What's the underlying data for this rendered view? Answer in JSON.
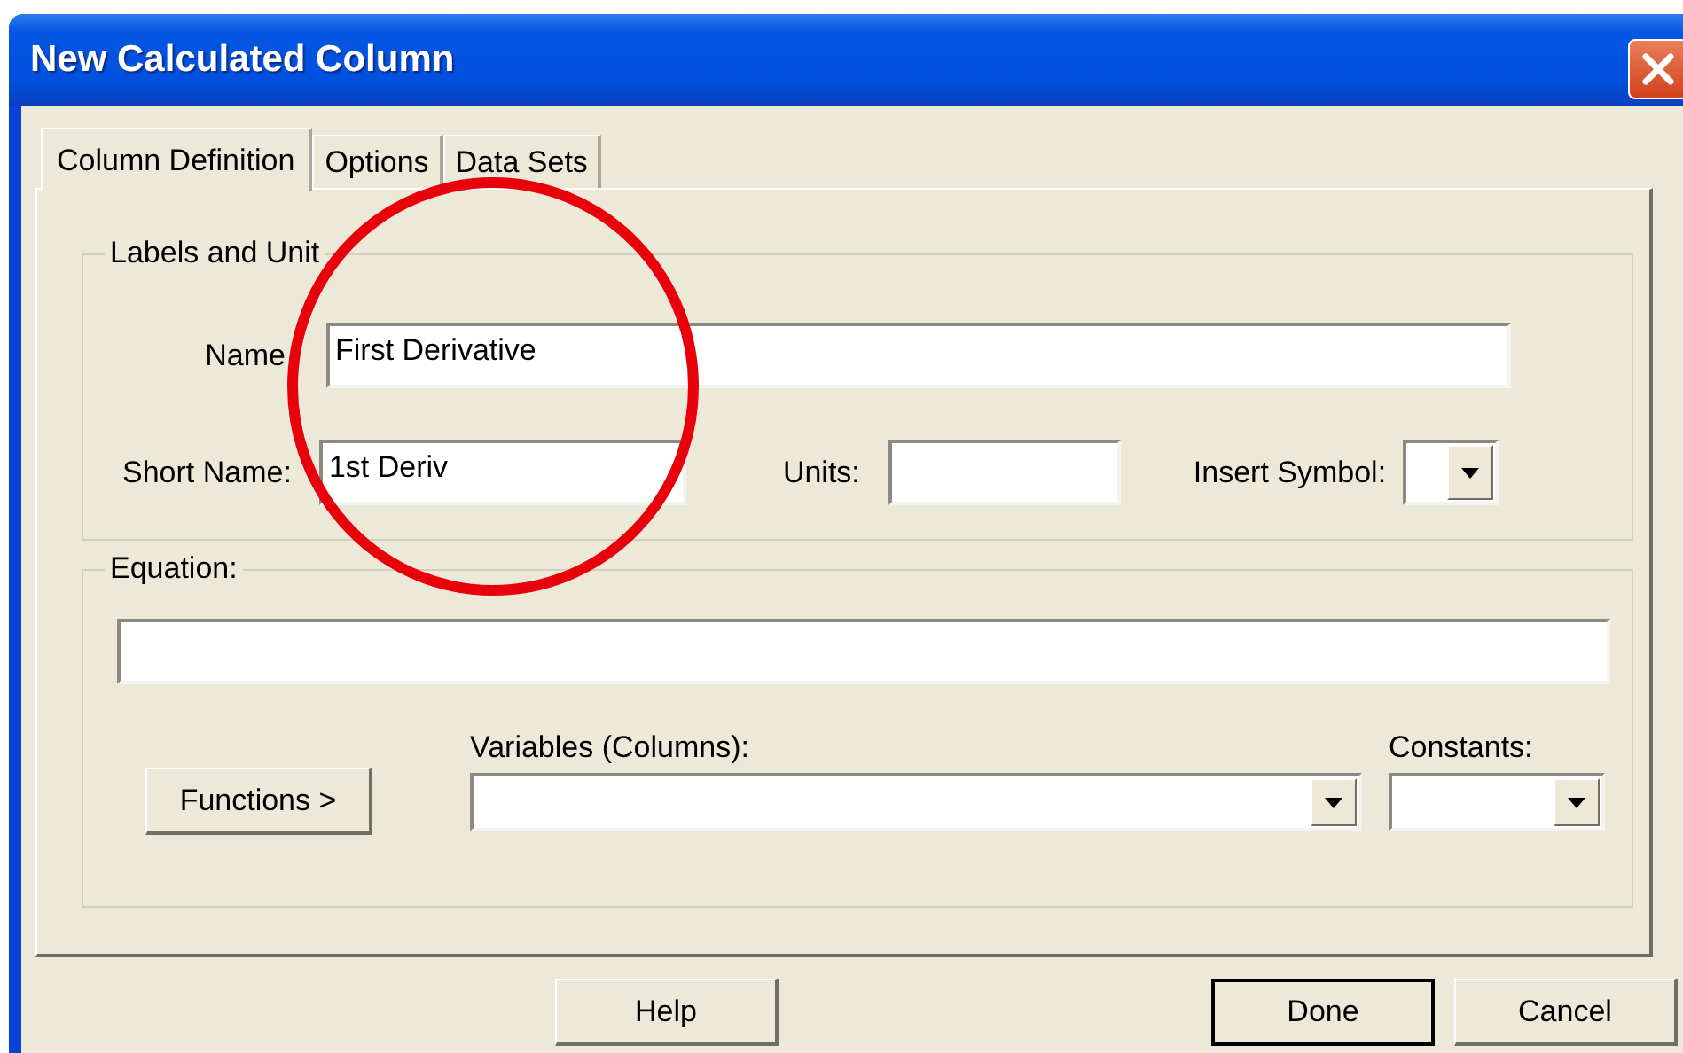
{
  "window": {
    "title": "New Calculated Column"
  },
  "tabs": [
    {
      "label": "Column Definition",
      "selected": true
    },
    {
      "label": "Options",
      "selected": false
    },
    {
      "label": "Data Sets",
      "selected": false
    }
  ],
  "labels_and_units": {
    "title": "Labels and Unit",
    "name": {
      "label": "Name",
      "value": "First Derivative"
    },
    "short_name": {
      "label": "Short Name:",
      "value": "1st Deriv"
    },
    "units": {
      "label": "Units:"
    },
    "insert_symbol": {
      "label": "Insert Symbol:"
    }
  },
  "equation": {
    "title": "Equation:",
    "functions_button": "Functions >",
    "variables": {
      "label": "Variables (Columns):"
    },
    "constants": {
      "label": "Constants:"
    }
  },
  "buttons": [
    {
      "label": "Help",
      "default": false
    },
    {
      "label": "Done",
      "default": true
    },
    {
      "label": "Cancel",
      "default": false
    }
  ]
}
